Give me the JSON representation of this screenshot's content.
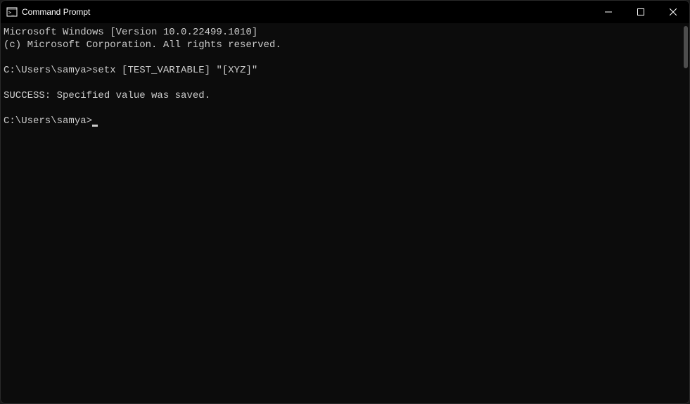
{
  "titlebar": {
    "title": "Command Prompt"
  },
  "terminal": {
    "line1": "Microsoft Windows [Version 10.0.22499.1010]",
    "line2": "(c) Microsoft Corporation. All rights reserved.",
    "blank1": "",
    "prompt1": "C:\\Users\\samya>",
    "command1": "setx [TEST_VARIABLE] \"[XYZ]\"",
    "blank2": "",
    "result": "SUCCESS: Specified value was saved.",
    "blank3": "",
    "prompt2": "C:\\Users\\samya>"
  }
}
